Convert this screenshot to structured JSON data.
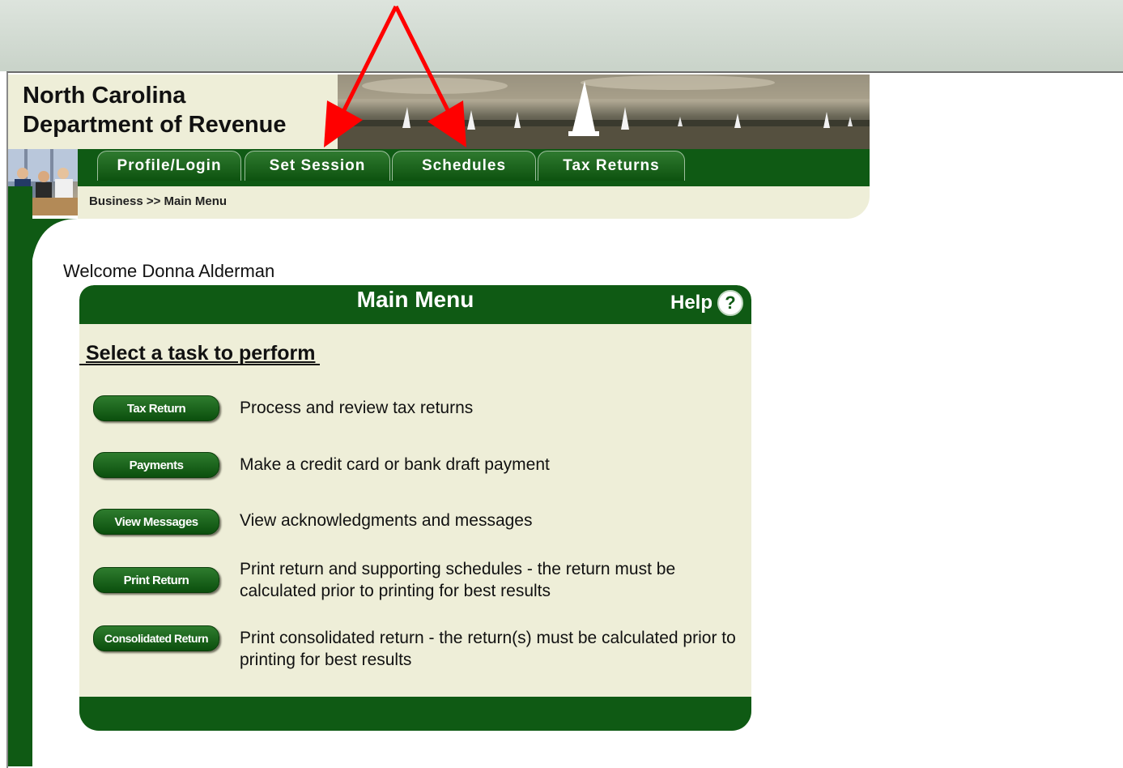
{
  "header": {
    "title_line1": "North Carolina",
    "title_line2": "Department of Revenue"
  },
  "nav": {
    "tabs": [
      {
        "label": "Profile/Login"
      },
      {
        "label": "Set Session"
      },
      {
        "label": "Schedules"
      },
      {
        "label": "Tax Returns"
      }
    ]
  },
  "breadcrumb": "Business >> Main Menu",
  "welcome": "Welcome Donna Alderman",
  "panel": {
    "title": "Main Menu",
    "help_label": "Help",
    "help_icon_glyph": "?",
    "task_heading": "Select a task to perform",
    "tasks": [
      {
        "button": "Tax Return",
        "description": "Process and review tax returns"
      },
      {
        "button": "Payments",
        "description": "Make a credit card or bank draft payment"
      },
      {
        "button": "View Messages",
        "description": "View acknowledgments and messages"
      },
      {
        "button": "Print Return",
        "description": "Print return and supporting schedules - the return must be calculated prior to printing for best results"
      },
      {
        "button": "Consolidated Return",
        "description": "Print consolidated return - the return(s) must be calculated prior to printing for best results"
      }
    ]
  },
  "colors": {
    "brand_green": "#0f5a14",
    "panel_beige": "#eeeed8",
    "annotation_arrow": "#ff0000"
  },
  "icons": {
    "help": "help-circle-icon",
    "annotation": "red-arrow-icon"
  }
}
